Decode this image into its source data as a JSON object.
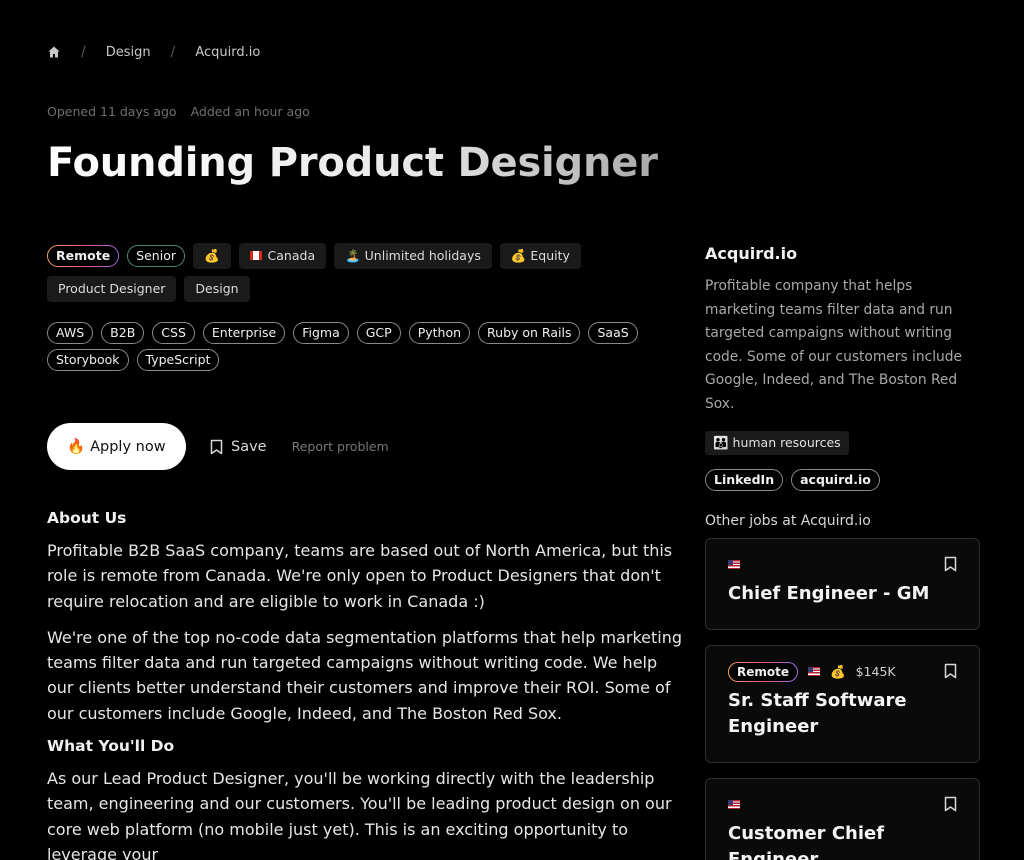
{
  "breadcrumb": {
    "home_icon": "home-icon",
    "items": [
      "Design",
      "Acquird.io"
    ]
  },
  "meta": {
    "opened": "Opened 11 days ago",
    "added": "Added an hour ago"
  },
  "title": "Founding Product Designer",
  "tags": {
    "remote": "Remote",
    "level": "Senior",
    "salary_emoji": "💰",
    "location": "Canada",
    "holidays": "🏝️ Unlimited holidays",
    "equity": "💰 Equity",
    "roles": [
      "Product Designer",
      "Design"
    ],
    "skills": [
      "AWS",
      "B2B",
      "CSS",
      "Enterprise",
      "Figma",
      "GCP",
      "Python",
      "Ruby on Rails",
      "SaaS",
      "Storybook",
      "TypeScript"
    ]
  },
  "actions": {
    "apply": "🔥 Apply now",
    "save": "Save",
    "report": "Report problem"
  },
  "content": {
    "about_heading": "About Us",
    "about_p1": "Profitable B2B SaaS company, teams are based out of North America, but this role is remote from Canada. We're only open to Product Designers that don't require relocation and are eligible to work in Canada :)",
    "about_p2": "We're one of the top no-code data segmentation platforms that help marketing teams filter data and run targeted campaigns without writing code. We help our clients better understand their customers and improve their ROI. Some of our customers include Google, Indeed, and The Boston Red Sox.",
    "do_heading": "What You'll Do",
    "do_p1": "As our Lead Product Designer, you'll be working directly with the leadership team, engineering and our customers. You'll be leading product design on our core web platform (no mobile just yet). This is an exciting opportunity to leverage your"
  },
  "company": {
    "name": "Acquird.io",
    "description": "Profitable company that helps marketing teams filter data and run targeted campaigns without writing code. Some of our customers include Google, Indeed, and The Boston Red Sox.",
    "industry": "👪 human resources",
    "links": [
      "LinkedIn",
      "acquird.io"
    ],
    "other_jobs_heading": "Other jobs at Acquird.io"
  },
  "other_jobs": [
    {
      "title": "Chief Engineer - GM",
      "remote": "",
      "flag": "🇺🇸",
      "salary": ""
    },
    {
      "title": "Sr. Staff Software Engineer",
      "remote": "Remote",
      "flag": "🇺🇸",
      "salary": "$145K"
    },
    {
      "title": "Customer Chief Engineer",
      "remote": "",
      "flag": "🇺🇸",
      "salary": ""
    }
  ]
}
